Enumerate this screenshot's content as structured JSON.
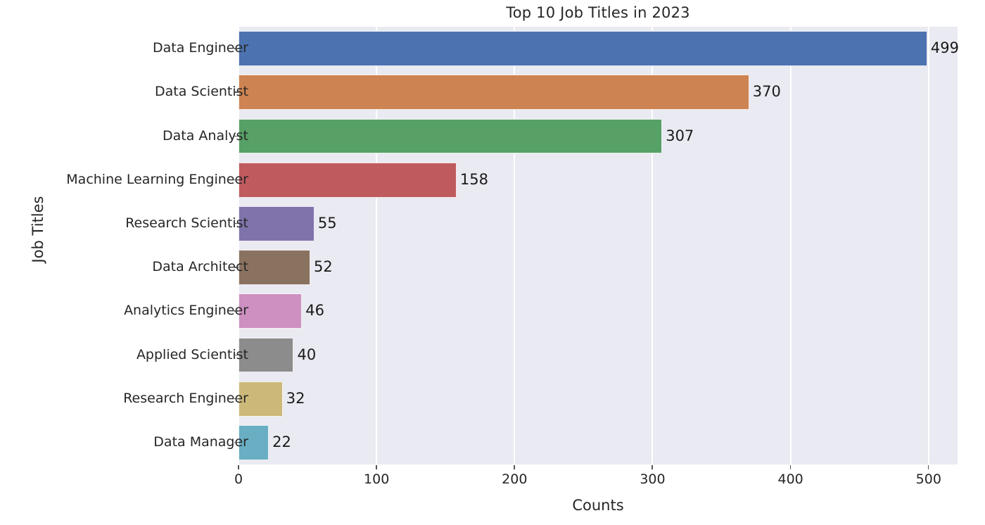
{
  "chart_data": {
    "type": "bar",
    "orientation": "horizontal",
    "title": "Top 10 Job Titles in 2023",
    "xlabel": "Counts",
    "ylabel": "Job Titles",
    "categories": [
      "Data Engineer",
      "Data Scientist",
      "Data Analyst",
      "Machine Learning Engineer",
      "Research Scientist",
      "Data Architect",
      "Analytics Engineer",
      "Applied Scientist",
      "Research Engineer",
      "Data Manager"
    ],
    "values": [
      499,
      370,
      307,
      158,
      55,
      52,
      46,
      40,
      32,
      22
    ],
    "value_labels": [
      "499",
      "370",
      "307",
      "158",
      "55",
      "52",
      "46",
      "40",
      "32",
      "22"
    ],
    "bar_colors": [
      "#4c72b0",
      "#cd8352",
      "#57a066",
      "#bf5b5e",
      "#8073ac",
      "#8a7260",
      "#cd90c0",
      "#8c8c8c",
      "#ccb97a",
      "#69aec2"
    ],
    "xlim": [
      0,
      521
    ],
    "xticks": [
      0,
      100,
      200,
      300,
      400,
      500
    ],
    "xtick_labels": [
      "0",
      "100",
      "200",
      "300",
      "400",
      "500"
    ],
    "grid": "vertical-only",
    "legend": "none",
    "plot_background": "#eaeaf2",
    "figure_background": "#ffffff",
    "gridline_color": "#ffffff",
    "text_color": "#262626"
  }
}
